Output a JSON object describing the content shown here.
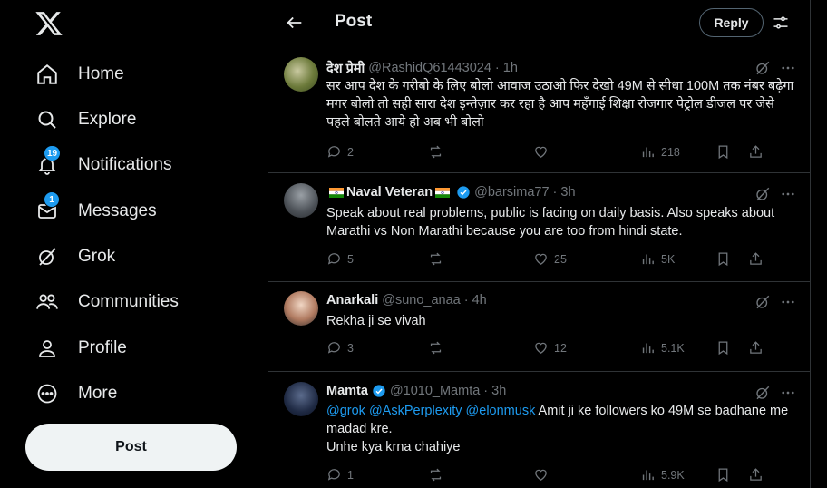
{
  "sidebar": {
    "nav": [
      {
        "label": "Home",
        "icon": "home-icon"
      },
      {
        "label": "Explore",
        "icon": "search-icon"
      },
      {
        "label": "Notifications",
        "icon": "bell-icon",
        "badge": "19"
      },
      {
        "label": "Messages",
        "icon": "mail-icon",
        "badge": "1"
      },
      {
        "label": "Grok",
        "icon": "grok-icon"
      },
      {
        "label": "Communities",
        "icon": "communities-icon"
      },
      {
        "label": "Profile",
        "icon": "profile-icon"
      },
      {
        "label": "More",
        "icon": "more-circle-icon"
      }
    ],
    "post_label": "Post"
  },
  "header": {
    "title": "Post",
    "reply_label": "Reply"
  },
  "tweets": [
    {
      "name": "देश प्रेमी",
      "handle": "@RashidQ61443024",
      "time": "· 1h",
      "text": "सर आप देश के गरीबो के लिए बोलो आवाज उठाओ फिर देखो 49M से सीधा 100M तक नंबर बढ़ेगा मगर बोलो तो सही सारा देश इन्तेज़ार कर रहा है आप महँगाई शिक्षा रोजगार पेट्रोल डीजल पर जेसे पहले बोलते आये हो अब भी बोलो",
      "replies": "2",
      "reposts": "",
      "likes": "",
      "views": "218"
    },
    {
      "name": "Naval Veteran",
      "handle": "@barsima77",
      "time": "· 3h",
      "text": "Speak about real problems, public is facing on daily basis. Also speaks about Marathi vs Non Marathi because you are too from hindi state.",
      "replies": "5",
      "reposts": "",
      "likes": "25",
      "views": "5K"
    },
    {
      "name": "Anarkali",
      "handle": "@suno_anaa",
      "time": "· 4h",
      "text": "Rekha ji se vivah",
      "replies": "3",
      "reposts": "",
      "likes": "12",
      "views": "5.1K"
    },
    {
      "name": "Mamta",
      "handle": "@1010_Mamta",
      "time": "· 3h",
      "mentions": "@grok @AskPerplexity @elonmusk",
      "text_after": " Amit ji ke followers ko 49M se badhane me madad kre.",
      "text_line2": "Unhe kya krna chahiye",
      "replies": "1",
      "reposts": "",
      "likes": "",
      "views": "5.9K"
    }
  ],
  "colors": {
    "accent": "#1d9bf0",
    "text": "#e7e9ea",
    "muted": "#71767b",
    "border": "#2f3336"
  }
}
